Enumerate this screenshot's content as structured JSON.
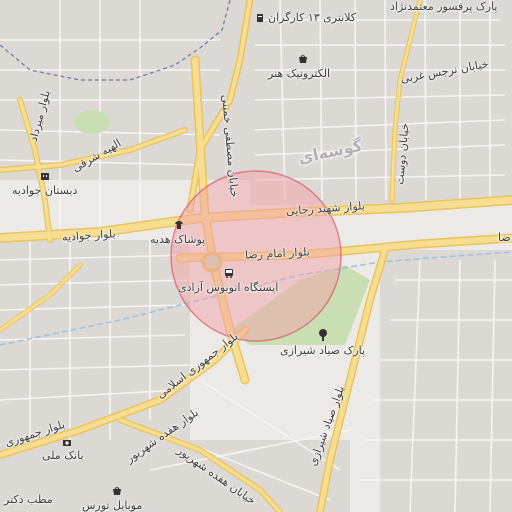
{
  "map": {
    "colors": {
      "background": "#eceae6",
      "block": "#d8d5d1",
      "street": "#ffffff",
      "major_road": "#f7dd8f",
      "major_road_casing": "#e9c35d",
      "park": "#c9dfb3",
      "railway": "#9fc3df",
      "boundary": "#6b7a99",
      "highlight_fill": "#f2a1a8",
      "highlight_stroke": "#d9485a"
    },
    "labels": {
      "park_motaamednejad": "پارک پرفسور معتمدنژاد",
      "kalantari": "کلانتری ۱۳ کارگران",
      "electronic_honar": "الکترونیک هنر",
      "narges_gharbi": "خیابان نرجس غربی",
      "boulevard_mirdamad": "بلوار میرداد",
      "alhiye_sharghi": "الهیه شرقی",
      "dabestan_javadieh": "دبستان جوادیه",
      "boulevard_javadieh": "بلوار جوادیه",
      "pooshak_hedyeh": "پوشاک هدیه",
      "shahid_rajaei": "بلوار شهید رجایی",
      "imam_reza": "بلوار امام رضا",
      "bus_station": "ایستگاه اتوبوس آزادی",
      "mostafa_khomeini": "خیابان مصطفی خمینی",
      "doust": "خیابان دوست",
      "gooshehei": "گوشه‌ای",
      "park_sayad": "پارک صیاد شیرازی",
      "jomhuri_eslami": "بلوار جمهوری اسلامی",
      "jomhuri_short": "بلوار جمهوری",
      "haft_tir": "بلوار هفده شهریور",
      "bank_melli": "بانک ملی",
      "sayad_blvd": "بلوار صیاد شیرازی",
      "khiaban_hefdah": "خیابان هفده شهریور",
      "mobile_tours": "موبایل تورس",
      "matab": "مطب دکتر",
      "edge_za": "ضا"
    },
    "icons": {
      "police": "police-icon",
      "shop": "shop-icon",
      "school": "school-icon",
      "clothing": "clothing-icon",
      "bus": "bus-icon",
      "park_tree": "tree-icon",
      "bank": "bank-icon",
      "mobile": "mobile-shop-icon"
    }
  }
}
